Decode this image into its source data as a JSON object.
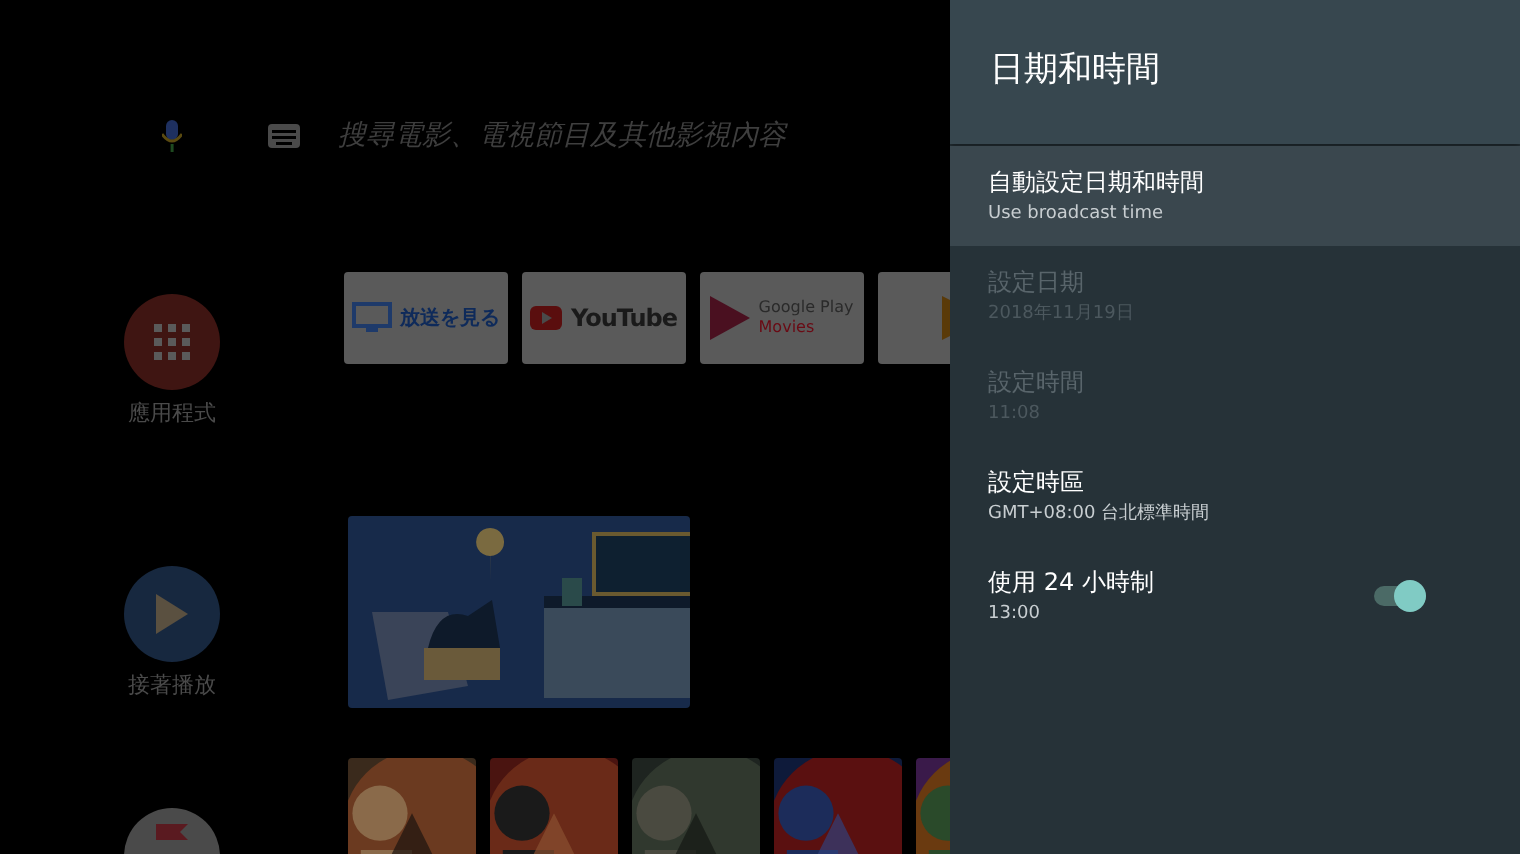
{
  "home": {
    "search": {
      "placeholder": "搜尋電影、電視節目及其他影視內容"
    },
    "nav": [
      {
        "kind": "apps",
        "label": "應用程式"
      },
      {
        "kind": "play",
        "label": "接著播放"
      },
      {
        "kind": "recommend"
      }
    ],
    "apps": [
      {
        "kind": "tv",
        "label": "放送を見る"
      },
      {
        "kind": "youtube",
        "label": "YouTube"
      },
      {
        "kind": "movies",
        "label": "Google Play",
        "sublabel": "Movies"
      },
      {
        "kind": "music"
      }
    ]
  },
  "settings": {
    "title": "日期和時間",
    "items": [
      {
        "title": "自動設定日期和時間",
        "subtitle": "Use broadcast time",
        "selected": true,
        "disabled": false
      },
      {
        "title": "設定日期",
        "subtitle": "2018年11月19日",
        "selected": false,
        "disabled": true
      },
      {
        "title": "設定時間",
        "subtitle": "11:08",
        "selected": false,
        "disabled": true
      },
      {
        "title": "設定時區",
        "subtitle": "GMT+08:00 台北標準時間",
        "selected": false,
        "disabled": false
      },
      {
        "title": "使用 24 小時制",
        "subtitle": "13:00",
        "selected": false,
        "disabled": false,
        "toggle": {
          "on": true
        }
      }
    ]
  }
}
